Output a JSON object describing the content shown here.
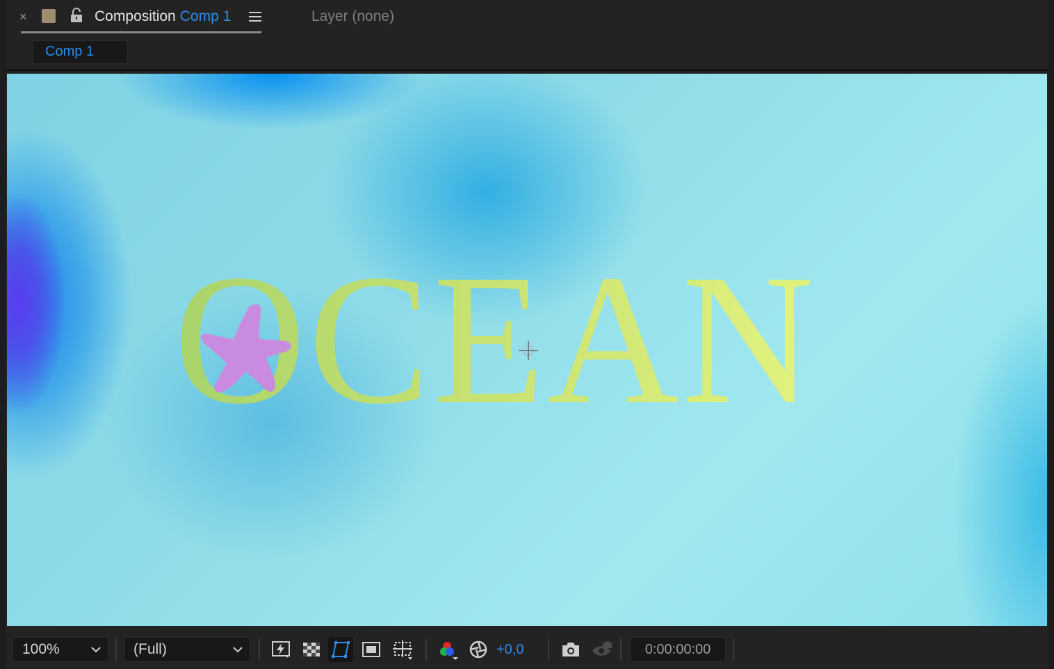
{
  "panel": {
    "close_glyph": "×",
    "label_color": "#a08c6e",
    "tab_prefix": "Composition",
    "tab_comp_name": "Comp 1",
    "layer_tab": "Layer (none)",
    "breadcrumb": "Comp 1"
  },
  "viewer": {
    "title_text": "OCEAN",
    "starfish_color": "#c88be0"
  },
  "toolbar": {
    "magnification": "100%",
    "resolution": "(Full)",
    "exposure": "+0,0",
    "timecode": "0:00:00:00",
    "icons": [
      "fast-previews-icon",
      "transparency-grid-icon",
      "mask-path-visibility-icon",
      "region-of-interest-icon",
      "grid-guides-icon",
      "color-channels-icon",
      "reset-exposure-icon",
      "snapshot-icon",
      "show-snapshot-icon"
    ]
  },
  "colors": {
    "accent": "#2d8ceb",
    "panel_bg": "#232323"
  }
}
